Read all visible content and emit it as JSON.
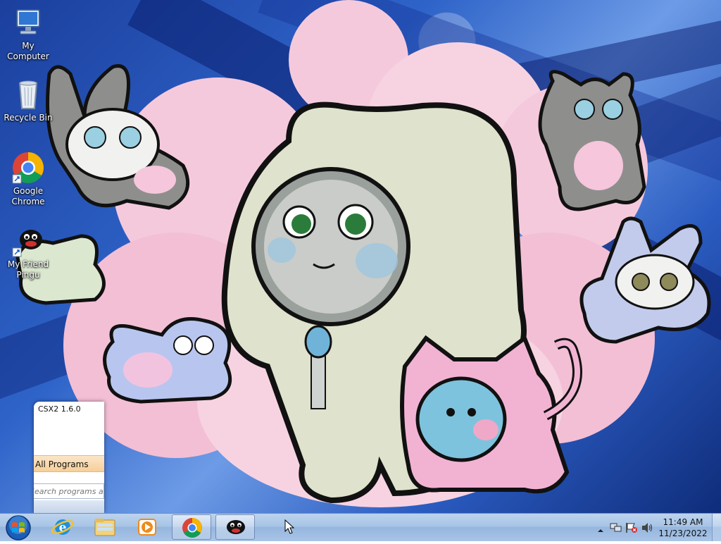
{
  "desktop": {
    "icons": [
      {
        "label": "My Computer",
        "icon": "computer-icon"
      },
      {
        "label": "Recycle Bin",
        "icon": "recycle-bin-icon"
      },
      {
        "label": "Google Chrome",
        "icon": "chrome-icon"
      },
      {
        "label": "My Friend Pingu",
        "icon": "pingu-icon"
      }
    ]
  },
  "start_menu": {
    "recent_item": "CSX2 1.6.0",
    "all_programs": "All Programs",
    "search_placeholder": "Search programs and files"
  },
  "taskbar": {
    "items": [
      {
        "name": "start-button",
        "icon": "windows-orb-icon"
      },
      {
        "name": "internet-explorer",
        "icon": "ie-icon"
      },
      {
        "name": "file-explorer",
        "icon": "folder-icon"
      },
      {
        "name": "media-player",
        "icon": "media-player-icon"
      },
      {
        "name": "google-chrome",
        "icon": "chrome-icon"
      },
      {
        "name": "my-friend-pingu",
        "icon": "pingu-icon"
      }
    ],
    "clock": {
      "time": "11:49 AM",
      "date": "11/23/2022"
    }
  },
  "colors": {
    "accent_blue": "#2e63c8",
    "taskbar": "#a8c4e6",
    "all_programs_highlight": "#f6cf98"
  }
}
